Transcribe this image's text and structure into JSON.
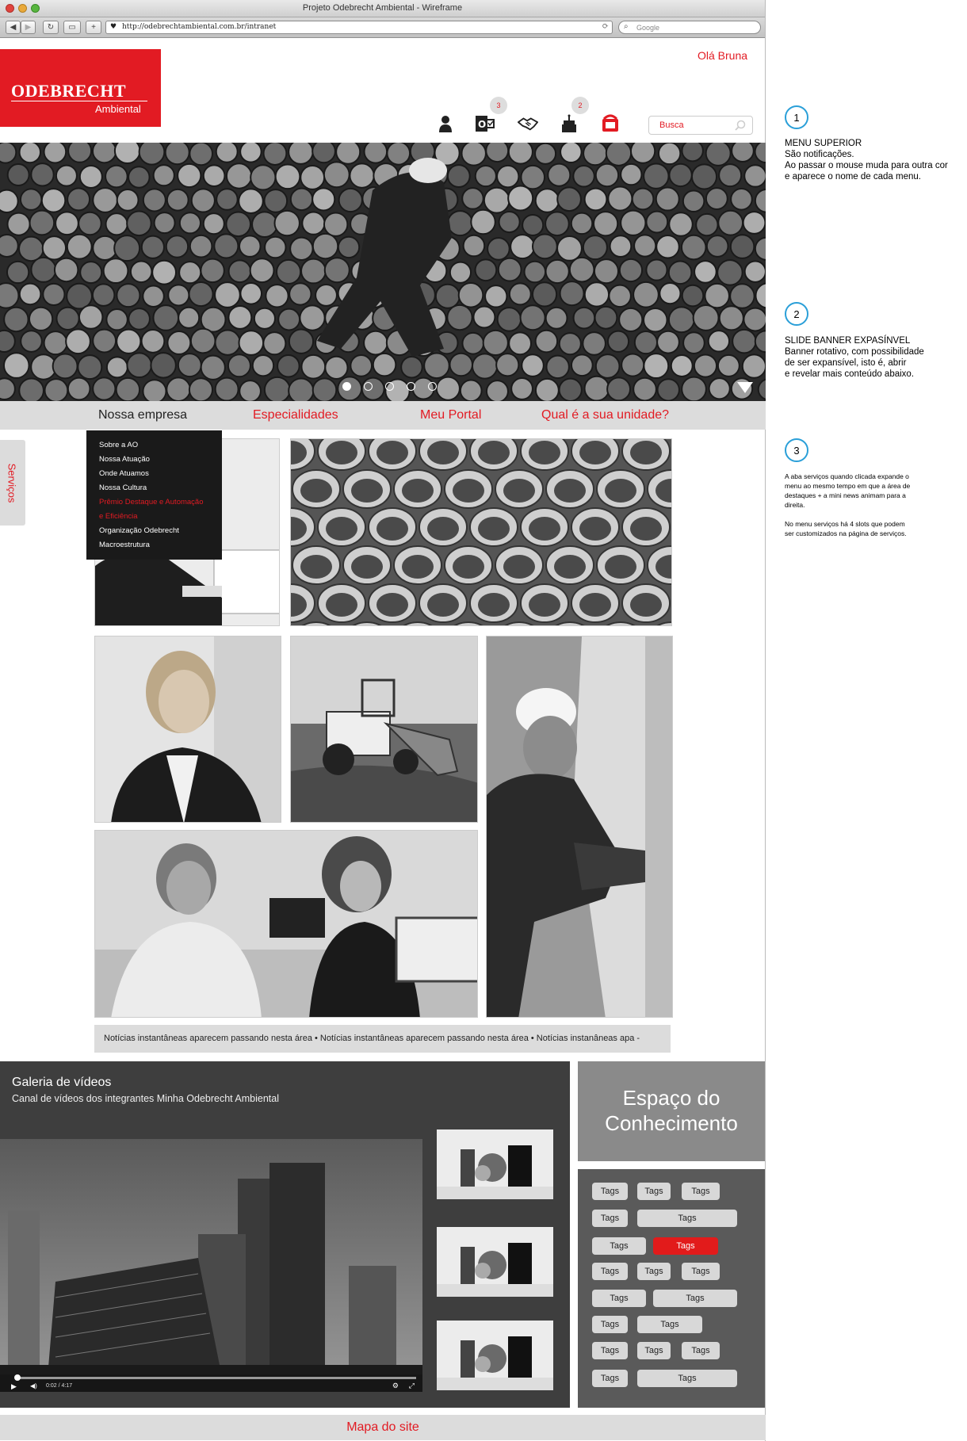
{
  "window": {
    "title": "Projeto Odebrecht Ambiental - Wireframe",
    "url": "http://odebrechtambiental.com.br/intranet",
    "search_placeholder": "Google"
  },
  "header": {
    "greeting": "Olá Bruna",
    "logo_brand": "ODEBRECHT",
    "logo_sub": "Ambiental",
    "search_placeholder": "Busca",
    "notifications": [
      {
        "icon": "user-icon"
      },
      {
        "icon": "outlook-icon",
        "badge": "3"
      },
      {
        "icon": "handshake-icon"
      },
      {
        "icon": "cake-icon",
        "badge": "2"
      },
      {
        "icon": "phone-support-icon"
      }
    ]
  },
  "banner": {
    "slides": 5,
    "active_slide": 1
  },
  "nav": {
    "items": [
      "Nossa empresa",
      "Especialidades",
      "Meu Portal",
      "Qual é a sua unidade?"
    ],
    "dropdown": [
      "Sobre a AO",
      "Nossa Atuação",
      "Onde Atuamos",
      "Nossa Cultura",
      "Prêmio Destaque e Automação",
      "e Eficiência",
      "Organização Odebrecht",
      "Macroestrutura"
    ]
  },
  "services_tab": "Serviços",
  "ticker": "Notícias instantâneas aparecem passando nesta área   •   Notícias instantâneas aparecem passando nesta área   •   Notícias instanâneas apa     -",
  "gallery": {
    "title": "Galeria de vídeos",
    "subtitle": "Canal de vídeos dos integrantes Minha Odebrecht Ambiental",
    "time": "0:02 / 4:17"
  },
  "knowledge": {
    "title_line1": "Espaço do",
    "title_line2": "Conhecimento",
    "tags": [
      "Tags",
      "Tags",
      "Tags",
      "Tags",
      "Tags",
      "Tags",
      "Tags",
      "Tags",
      "Tags",
      "Tags",
      "Tags",
      "Tags",
      "Tags",
      "Tags",
      "Tags",
      "Tags",
      "Tags",
      "Tags",
      "Tags"
    ]
  },
  "footer": {
    "sitemap": "Mapa do site"
  },
  "annotations": [
    {
      "num": "1",
      "text": "MENU SUPERIOR\nSão notificações.\nAo passar o mouse muda para outra cor\ne aparece o nome de cada menu."
    },
    {
      "num": "2",
      "text": "SLIDE BANNER EXPASÍNVEL\nBanner rotativo, com possibilidade\nde ser expansível, isto é, abrir\ne revelar mais conteúdo abaixo."
    },
    {
      "num": "3",
      "text": "A aba serviços quando clicada expande o\nmenu ao mesmo tempo em que a área de\ndestaques + a mini news animam para a\ndireita.\n\nNo menu serviços há 4 slots que podem\nser customizados na página de serviços."
    }
  ],
  "colors": {
    "brand_red": "#e21b23",
    "annotation_blue": "#2a9fd8"
  }
}
